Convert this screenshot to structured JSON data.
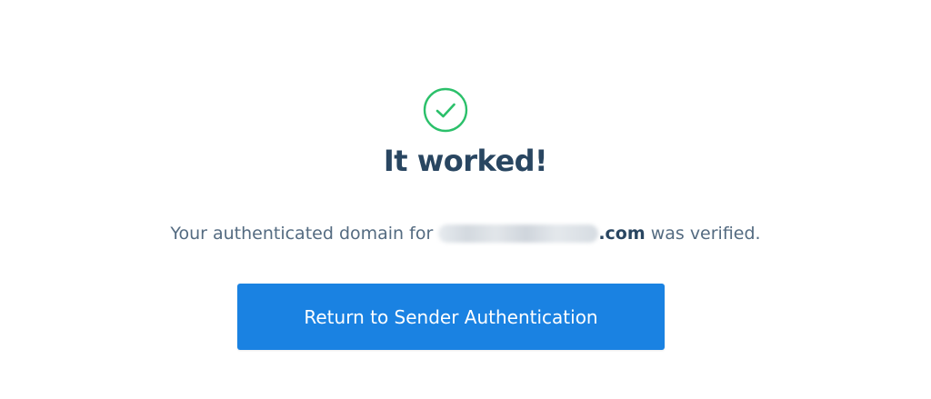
{
  "status": {
    "icon": "check-circle-icon",
    "title": "It worked!",
    "success_color": "#2bc06a"
  },
  "message": {
    "prefix": "Your authenticated domain for ",
    "domain_suffix": ".com",
    "suffix": " was verified."
  },
  "actions": {
    "return_label": "Return to Sender Authentication",
    "button_color": "#1a82e2"
  },
  "colors": {
    "heading": "#294661",
    "body_text": "#546b81"
  }
}
